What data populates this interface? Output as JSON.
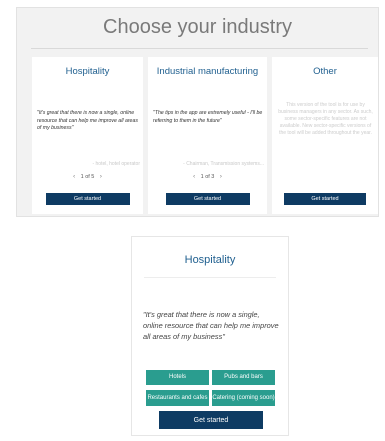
{
  "panel": {
    "title": "Choose your industry",
    "cards": [
      {
        "title": "Hospitality",
        "quote": "\"It's great that there is now a single, online resource that can help me improve all areas of my business\"",
        "attribution": "- hotel, hotel operator",
        "pager": {
          "prev": "‹",
          "label": "1 of 5",
          "next": "›"
        },
        "button": "Get started"
      },
      {
        "title": "Industrial manufacturing",
        "quote": "\"The tips in the app are extremely useful - I'll be referring to them in the future\"",
        "attribution": "- Chairman, Transmission systems...",
        "pager": {
          "prev": "‹",
          "label": "1 of 3",
          "next": "›"
        },
        "button": "Get started"
      },
      {
        "title": "Other",
        "text": "This version of the tool is for use by business managers in any sector. As such, some sector-specific features are not available. New sector-specific versions of the tool will be added throughout the year.",
        "button": "Get started"
      }
    ]
  },
  "mobile": {
    "title": "Hospitality",
    "quote": "\"It's great that there is now a single, online resource that can help me improve all areas of my business\"",
    "tags": [
      "Hotels",
      "Pubs and bars",
      "Restaurants and cafes",
      "Catering (coming soon)"
    ],
    "button": "Get started"
  },
  "colors": {
    "accent": "#1f5f8f",
    "button": "#0e3b63",
    "tag": "#2a9d8f",
    "panel_bg": "#f2f2f2"
  }
}
